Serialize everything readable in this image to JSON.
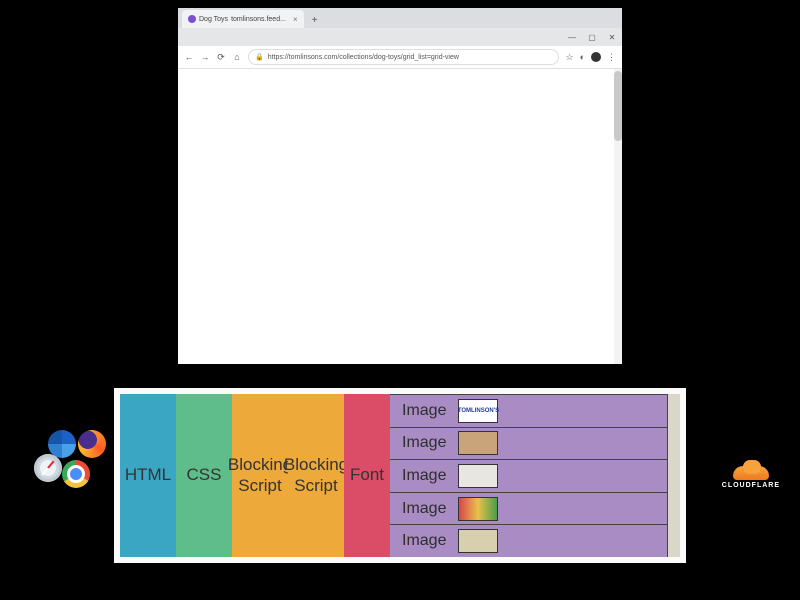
{
  "browser": {
    "window_buttons": {
      "min": "—",
      "max": "▢",
      "close": "✕"
    },
    "tab": {
      "icon_label": "Dog Toys",
      "title": "tomlinsons.feed..."
    },
    "newtab": "+",
    "nav": {
      "back": "←",
      "forward": "→",
      "reload": "⟳",
      "home": "⌂"
    },
    "url": {
      "lock": "🔒",
      "text": "https://tomlinsons.com/collections/dog-toys/grid_list=grid-view"
    },
    "right": {
      "star": "☆",
      "ext": "◐",
      "menu": "⋮"
    }
  },
  "waterfall": {
    "html": "HTML",
    "css": "CSS",
    "blocking_script": "Blocking Script",
    "font": "Font",
    "image_label": "Image",
    "rows": [
      {
        "thumb": "TOMLINSON'S"
      },
      {
        "thumb": ""
      },
      {
        "thumb": ""
      },
      {
        "thumb": ""
      },
      {
        "thumb": ""
      }
    ]
  },
  "cloudflare": {
    "name": "CLOUDFLARE"
  }
}
